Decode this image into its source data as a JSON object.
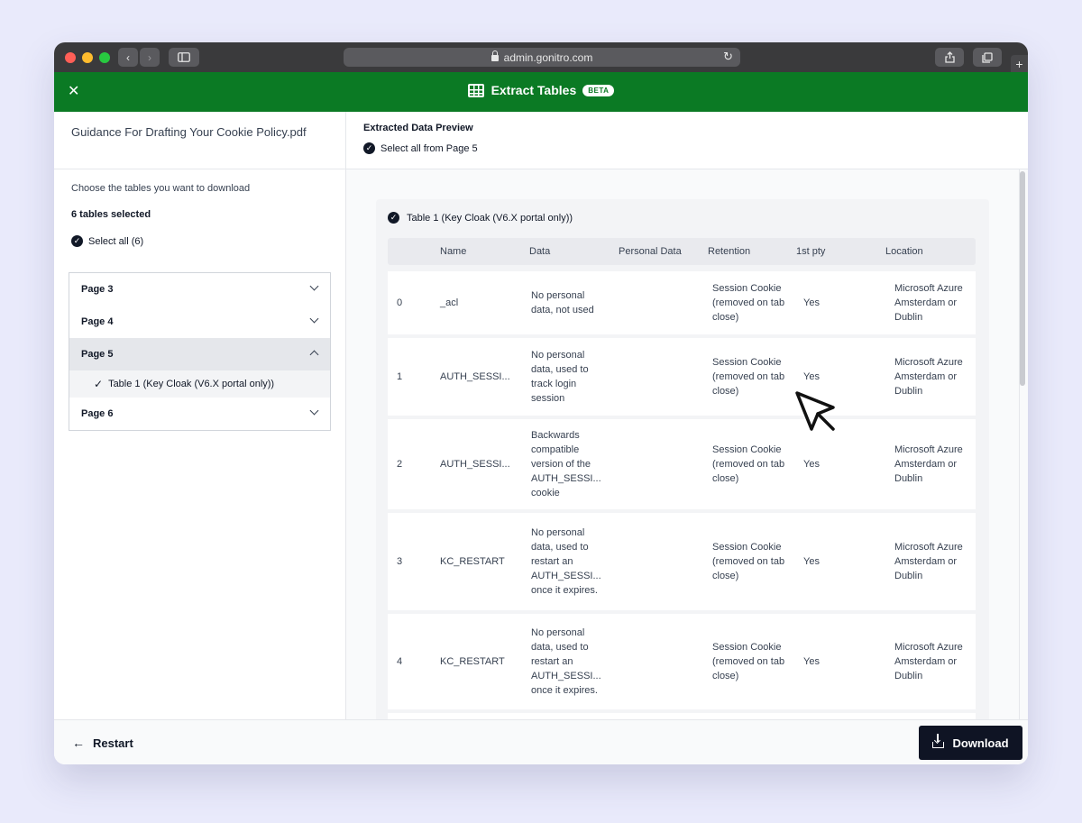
{
  "browser": {
    "url": "admin.gonitro.com"
  },
  "header": {
    "title": "Extract Tables",
    "badge": "BETA"
  },
  "left": {
    "filename": "Guidance For Drafting Your Cookie Policy.pdf",
    "instruction": "Choose the tables you want to download",
    "selected_count": "6 tables selected",
    "select_all": "Select all (6)",
    "pages": [
      {
        "label": "Page 3"
      },
      {
        "label": "Page 4"
      },
      {
        "label": "Page 5"
      },
      {
        "label": "Page 6"
      }
    ],
    "page5_table": "Table 1 (Key Cloak (V6.X portal only))"
  },
  "right": {
    "preview_title": "Extracted Data Preview",
    "select_page": "Select all from Page 5",
    "table_title": "Table 1 (Key Cloak (V6.X portal only))",
    "columns": [
      "Name",
      "Data",
      "Personal Data",
      "Retention",
      "1st pty",
      "Location"
    ],
    "rows": [
      {
        "idx": "0",
        "name": "_acl",
        "data": "No personal data, not used",
        "personal": "",
        "retention": "Session Cookie (removed on tab close)",
        "first": "Yes",
        "location": "Microsoft Azure Amsterdam or Dublin"
      },
      {
        "idx": "1",
        "name": "AUTH_SESSI...",
        "data": "No personal data, used to track login session",
        "personal": "",
        "retention": "Session Cookie (removed on tab close)",
        "first": "Yes",
        "location": "Microsoft Azure Amsterdam or Dublin"
      },
      {
        "idx": "2",
        "name": "AUTH_SESSI...",
        "data": "Backwards compatible version of the AUTH_SESSI... cookie",
        "personal": "",
        "retention": "Session Cookie (removed on tab close)",
        "first": "Yes",
        "location": "Microsoft Azure Amsterdam or Dublin"
      },
      {
        "idx": "3",
        "name": "KC_RESTART",
        "data": "No personal data, used to restart an AUTH_SESSI... once it expires.",
        "personal": "",
        "retention": "Session Cookie (removed on tab close)",
        "first": "Yes",
        "location": "Microsoft Azure Amsterdam or Dublin"
      },
      {
        "idx": "4",
        "name": "KC_RESTART",
        "data": "No personal data, used to restart an AUTH_SESSI... once it expires.",
        "personal": "",
        "retention": "Session Cookie (removed on tab close)",
        "first": "Yes",
        "location": "Microsoft Azure Amsterdam or Dublin"
      }
    ]
  },
  "footer": {
    "restart": "Restart",
    "download": "Download"
  }
}
